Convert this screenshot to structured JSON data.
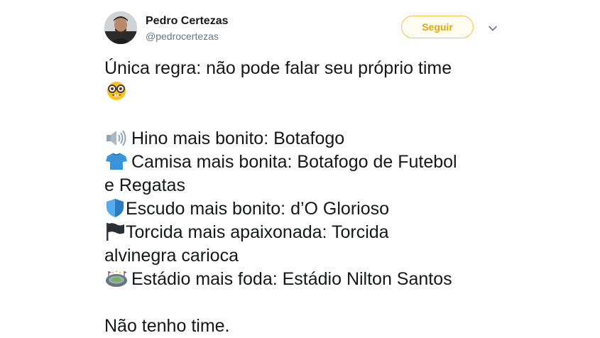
{
  "author": {
    "name": "Pedro Certezas",
    "handle": "@pedrocertezas"
  },
  "follow_label": "Seguir",
  "icons": {
    "more": "chevron-down-icon",
    "nerd": "nerd-face-emoji",
    "speaker": "speaker-emoji",
    "shirt": "tshirt-emoji",
    "shield": "shield-emoji",
    "flag": "black-flag-emoji",
    "stadium": "stadium-emoji"
  },
  "colors": {
    "follow_border": "#f0c44a",
    "follow_text": "#e1a800",
    "handle": "#657786",
    "text": "#14171a"
  },
  "tweet": {
    "line1": "Única regra: não pode falar seu próprio time",
    "hino": "Hino mais bonito: Botafogo",
    "camisa_1": "Camisa mais bonita: Botafogo de Futebol",
    "camisa_2": "e Regatas",
    "escudo": "Escudo mais bonito: d’O Glorioso",
    "torcida_1": "Torcida mais apaixonada: Torcida",
    "torcida_2": "alvinegra carioca",
    "estadio": "Estádio mais foda: Estádio Nilton Santos",
    "closing": "Não tenho time."
  }
}
